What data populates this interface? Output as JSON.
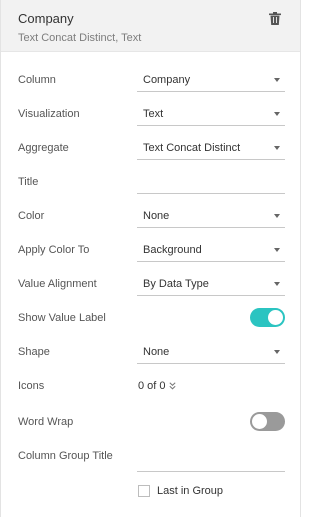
{
  "header": {
    "title": "Company",
    "subtitle": "Text Concat Distinct, Text"
  },
  "fields": {
    "column": {
      "label": "Column",
      "value": "Company"
    },
    "visualization": {
      "label": "Visualization",
      "value": "Text"
    },
    "aggregate": {
      "label": "Aggregate",
      "value": "Text Concat Distinct"
    },
    "title": {
      "label": "Title",
      "value": ""
    },
    "color": {
      "label": "Color",
      "value": "None"
    },
    "apply_color_to": {
      "label": "Apply Color To",
      "value": "Background"
    },
    "value_alignment": {
      "label": "Value Alignment",
      "value": "By Data Type"
    },
    "show_value_label": {
      "label": "Show Value Label",
      "on": true
    },
    "shape": {
      "label": "Shape",
      "value": "None"
    },
    "icons": {
      "label": "Icons",
      "value": "0 of 0"
    },
    "word_wrap": {
      "label": "Word Wrap",
      "on": false
    },
    "column_group_title": {
      "label": "Column Group Title",
      "value": ""
    },
    "last_in_group": {
      "label": "Last in Group",
      "checked": false
    }
  },
  "colors": {
    "toggle_on": "#2bc4c1",
    "toggle_off": "#9a9a9a",
    "header_bg": "#f2f2f2"
  },
  "icons": {
    "delete": "trash-icon",
    "dropdown": "caret-down-icon",
    "expand": "double-chevron-down-icon"
  }
}
